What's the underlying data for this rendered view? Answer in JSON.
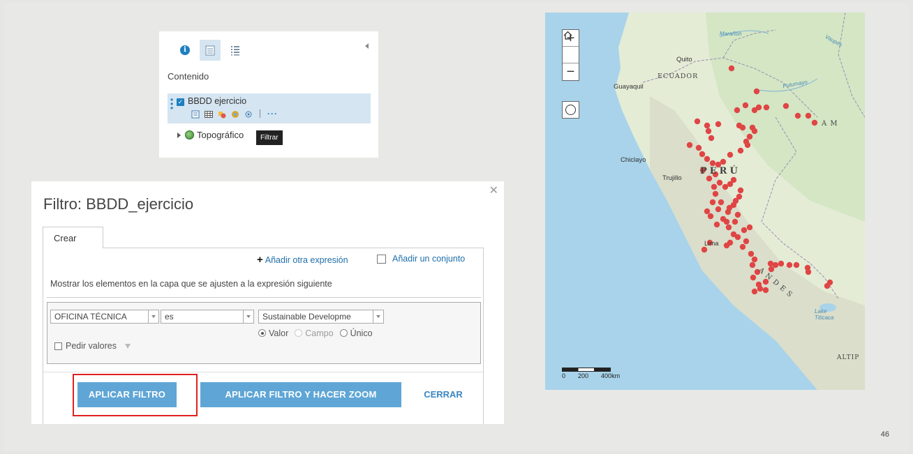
{
  "page_number": "46",
  "layer_panel": {
    "title": "Contenido",
    "layers": [
      {
        "name": "BBDD ejercicio",
        "checked": true
      },
      {
        "name": "Topográfico"
      }
    ],
    "tooltip": "Filtrar",
    "tab_icons": [
      "info-icon",
      "layers-icon",
      "legend-icon"
    ],
    "tool_icons": [
      "filter-icon",
      "table-icon",
      "symbol-icon",
      "style-icon",
      "zoom-icon",
      "more-icon"
    ]
  },
  "filter_dialog": {
    "title": "Filtro: BBDD_ejercicio",
    "tab_label": "Crear",
    "add_expression": "Añadir otra expresión",
    "add_set": "Añadir un conjunto",
    "instruction": "Mostrar los elementos en la capa que se ajusten a la expresión siguiente",
    "field_value": "OFICINA TÉCNICA",
    "operator_value": "es",
    "value_value": "Sustainable Developme",
    "radio_options": [
      "Valor",
      "Campo",
      "Único"
    ],
    "radio_selected": "Valor",
    "ask_values_label": "Pedir valores",
    "apply_label": "APLICAR FILTRO",
    "apply_zoom_label": "APLICAR FILTRO Y HACER ZOOM",
    "close_label": "CERRAR",
    "colors": {
      "button": "#5fa6d6",
      "highlight": "#e02020"
    }
  },
  "map": {
    "controls": {
      "zoom_in": "+",
      "home": "⌂",
      "zoom_out": "−"
    },
    "labels": {
      "quito": "Quito",
      "ecuador": "ECUADOR",
      "guayaquil": "Guayaquil",
      "chiclayo": "Chiclayo",
      "trujillo": "Trujillo",
      "peru": "PERÚ",
      "lima": "Lima",
      "am": "A   M",
      "andes": "A N D E S",
      "altip": "ALTIP",
      "lake": "Lake Titicaca",
      "putumayo": "Putumayo",
      "maranon": "Marañón",
      "vaupes": "Vaupés"
    },
    "scale_labels": [
      "0",
      "200",
      "400km"
    ],
    "point_color": "#e04545"
  }
}
